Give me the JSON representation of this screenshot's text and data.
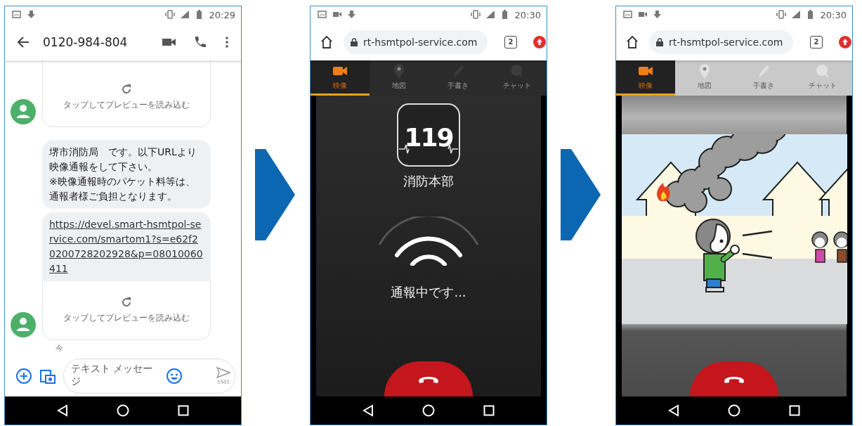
{
  "phones": [
    {
      "kind": "messages",
      "status": {
        "time": "20:29"
      },
      "header": {
        "title": "0120-984-804"
      },
      "messages": [
        {
          "kind": "preview",
          "text": "タップしてプレビューを読み込む"
        },
        {
          "kind": "text",
          "text": "堺市消防局　です。以下URLより映像通報をして下さい。　　　　　※映像通報時のパケット料等は、通報者様ご負担となります。"
        },
        {
          "kind": "link",
          "text": "https://devel.smart-hsmtpol-service.com/smartom1?s=e62f20200728202928&p=08010060411"
        },
        {
          "kind": "preview",
          "text": "タップしてプレビューを読み込む"
        }
      ],
      "timestamp": "今",
      "compose": {
        "placeholder": "テキスト メッセージ",
        "send_label": "SMS"
      }
    },
    {
      "kind": "call",
      "status": {
        "time": "20:30"
      },
      "browser": {
        "url": "rt-hsmtpol-service.com",
        "tab_count": "2"
      },
      "tabs": [
        {
          "label": "映像",
          "selected": true
        },
        {
          "label": "地図",
          "selected": false
        },
        {
          "label": "手書き",
          "selected": false
        },
        {
          "label": "チャット",
          "selected": false
        }
      ],
      "logo": {
        "text": "119",
        "caption": "消防本部"
      },
      "message": "通報中です..."
    },
    {
      "kind": "video",
      "status": {
        "time": "20:30"
      },
      "browser": {
        "url": "rt-hsmtpol-service.com",
        "tab_count": "2"
      },
      "tabs": [
        {
          "label": "映像",
          "selected": true
        },
        {
          "label": "地図",
          "selected": false
        },
        {
          "label": "手書き",
          "selected": false
        },
        {
          "label": "チャット",
          "selected": false
        }
      ]
    }
  ]
}
